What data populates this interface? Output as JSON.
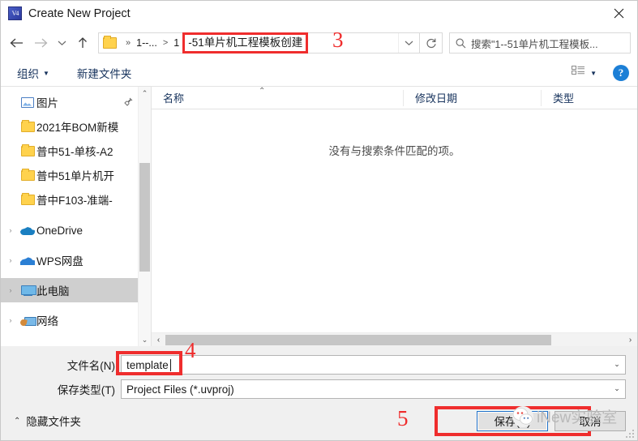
{
  "window": {
    "title": "Create New Project",
    "icon": "keil-uvision-icon",
    "close_label": "✕"
  },
  "nav": {
    "back": "←",
    "forward": "→",
    "recent": "⌄",
    "up": "↑",
    "refresh": "↺",
    "dropdown": "⌄"
  },
  "address": {
    "crumb1": "1--...",
    "sep1": "»",
    "sep2": ">",
    "crumb2": "1",
    "crumb_highlight": "-51单片机工程模板创建"
  },
  "search": {
    "icon": "search-icon",
    "placeholder": "搜索\"1--51单片机工程模板..."
  },
  "toolbar": {
    "organize": "组织",
    "new_folder": "新建文件夹",
    "view_mode": "list-view-icon",
    "help": "?"
  },
  "sidebar": {
    "items": [
      {
        "label": "图片",
        "icon": "pictures-icon",
        "expander": "",
        "pinned": true,
        "selected": false
      },
      {
        "label": "2021年BOM新模",
        "icon": "folder-icon",
        "expander": "",
        "pinned": false,
        "selected": false
      },
      {
        "label": "普中51-单核-A2",
        "icon": "folder-icon",
        "expander": "",
        "pinned": false,
        "selected": false
      },
      {
        "label": "普中51单片机开",
        "icon": "folder-icon",
        "expander": "",
        "pinned": false,
        "selected": false
      },
      {
        "label": "普中F103-准端-",
        "icon": "folder-icon",
        "expander": "",
        "pinned": false,
        "selected": false
      },
      {
        "label": "OneDrive",
        "icon": "onedrive-icon",
        "expander": "›",
        "pinned": false,
        "selected": false
      },
      {
        "label": "WPS网盘",
        "icon": "wps-cloud-icon",
        "expander": "›",
        "pinned": false,
        "selected": false
      },
      {
        "label": "此电脑",
        "icon": "this-pc-icon",
        "expander": "›",
        "pinned": false,
        "selected": true
      },
      {
        "label": "网络",
        "icon": "network-icon",
        "expander": "›",
        "pinned": false,
        "selected": false
      }
    ],
    "scroll_up": "⌃",
    "scroll_down": "⌄"
  },
  "filelist": {
    "columns": [
      "名称",
      "修改日期",
      "类型"
    ],
    "sort_indicator": "⌃",
    "empty_message": "没有与搜索条件匹配的项。",
    "rows": [],
    "scroll_left": "‹",
    "scroll_right": "›"
  },
  "form": {
    "filename_label": "文件名(N)",
    "filename_value": "template",
    "filetype_label": "保存类型(T)",
    "filetype_value": "Project Files (*.uvproj)",
    "combo_arrow": "⌄"
  },
  "footer": {
    "hide_folders": "隐藏文件夹",
    "hide_chevron": "⌃",
    "save_button": "保存(S)",
    "cancel_button": "取消"
  },
  "annotations": {
    "three": "3",
    "four": "4",
    "five": "5",
    "color": "#ef2d2d"
  },
  "watermark": {
    "text": "iNew实验室",
    "logo": "wechat-logo"
  }
}
